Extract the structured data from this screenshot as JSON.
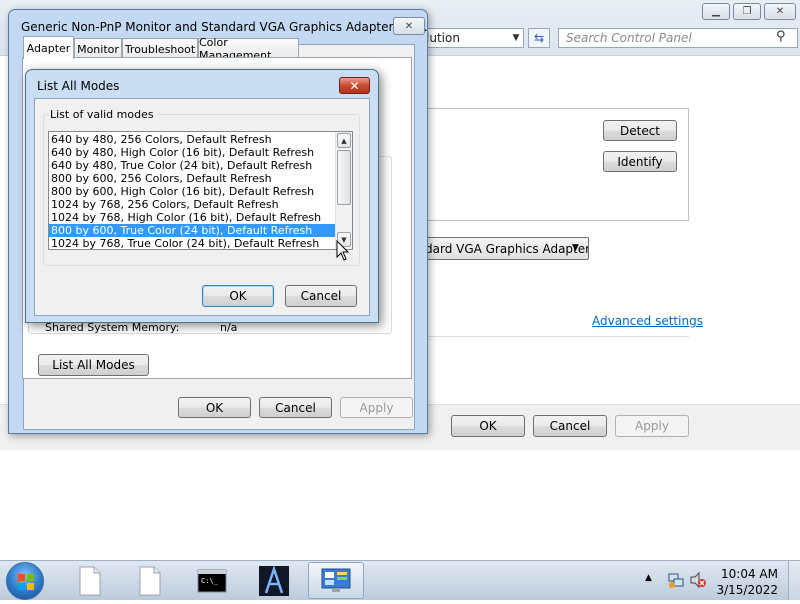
{
  "control_panel": {
    "address_text": "lution",
    "search_placeholder": "Search Control Panel",
    "detect_label": "Detect",
    "identify_label": "Identify",
    "display_combo_value": "dard VGA Graphics Adapter",
    "advanced_settings_label": "Advanced settings",
    "ok_label": "OK",
    "cancel_label": "Cancel",
    "apply_label": "Apply"
  },
  "properties_dialog": {
    "title": "Generic Non-PnP Monitor and Standard VGA Graphics Adapter Pro...",
    "tabs": [
      {
        "label": "Adapter",
        "active": true
      },
      {
        "label": "Monitor",
        "active": false
      },
      {
        "label": "Troubleshoot",
        "active": false
      },
      {
        "label": "Color Management",
        "active": false
      }
    ],
    "shared_memory_label": "Shared System Memory:",
    "shared_memory_value": "n/a",
    "list_all_modes_label": "List All Modes",
    "ok_label": "OK",
    "cancel_label": "Cancel",
    "apply_label": "Apply"
  },
  "list_all_modes_dialog": {
    "title": "List All Modes",
    "group_label": "List of valid modes",
    "modes": [
      "640 by 480, 256 Colors, Default Refresh",
      "640 by 480, High Color (16 bit), Default Refresh",
      "640 by 480, True Color (24 bit), Default Refresh",
      "800 by 600, 256 Colors, Default Refresh",
      "800 by 600, High Color (16 bit), Default Refresh",
      "1024 by 768, 256 Colors, Default Refresh",
      "1024 by 768, High Color (16 bit), Default Refresh",
      "800 by 600, True Color (24 bit), Default Refresh",
      "1024 by 768, True Color (24 bit), Default Refresh"
    ],
    "selected_mode": "800 by 600, True Color (24 bit), Default Refresh",
    "ok_label": "OK",
    "cancel_label": "Cancel"
  },
  "taskbar": {
    "time": "10:04 AM",
    "date": "3/15/2022",
    "items": [
      "document-icon",
      "document-icon",
      "command-prompt-icon",
      "app-a-icon",
      "control-panel-icon"
    ],
    "tray_icons": [
      "show-hidden-icons-arrow",
      "network-icon",
      "volume-muted-icon"
    ]
  },
  "colors": {
    "selection": "#3399ff",
    "link": "#0066cc",
    "close_button": "#c84a30"
  }
}
